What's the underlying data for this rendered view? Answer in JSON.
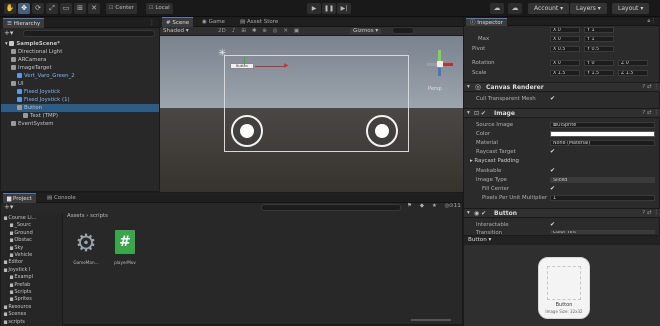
{
  "toolbar": {
    "center_label": "Center",
    "local_label": "Local",
    "account_label": "Account",
    "layers_label": "Layers",
    "layout_label": "Layout"
  },
  "hierarchy": {
    "tab": "Hierarchy",
    "add": "+",
    "items": [
      {
        "label": "SampleScene*",
        "indent": 0,
        "bold": true
      },
      {
        "label": "Directional Light",
        "indent": 1
      },
      {
        "label": "ARCamera",
        "indent": 1
      },
      {
        "label": "ImageTarget",
        "indent": 1
      },
      {
        "label": "Vert_Varo_Green_2",
        "indent": 2,
        "blue": true
      },
      {
        "label": "UI",
        "indent": 1
      },
      {
        "label": "Fixed Joystick",
        "indent": 2,
        "blue": true
      },
      {
        "label": "Fixed Joystick (1)",
        "indent": 2,
        "blue": true
      },
      {
        "label": "Button",
        "indent": 2,
        "selected": true
      },
      {
        "label": "Text (TMP)",
        "indent": 3
      },
      {
        "label": "EventSystem",
        "indent": 1
      }
    ]
  },
  "scene": {
    "tabs": [
      "Scene",
      "Game",
      "Asset Store"
    ],
    "shaded": "Shaded",
    "mode_2d": "2D",
    "gizmos": "Gizmos",
    "persp": "Persp",
    "button_text": "Button"
  },
  "project": {
    "tabs": [
      "Project",
      "Console"
    ],
    "breadcrumb": [
      "Assets",
      "scripts"
    ],
    "search_placeholder": "",
    "item_count": "11",
    "tree": [
      {
        "label": "Course Li...",
        "indent": 0
      },
      {
        "label": "_Sourc",
        "indent": 1
      },
      {
        "label": "Ground",
        "indent": 1
      },
      {
        "label": "Obstac",
        "indent": 1
      },
      {
        "label": "Sky",
        "indent": 1
      },
      {
        "label": "Vehicle",
        "indent": 1
      },
      {
        "label": "Editor",
        "indent": 0
      },
      {
        "label": "Joystick I",
        "indent": 0
      },
      {
        "label": "Exampl",
        "indent": 1
      },
      {
        "label": "Prefab",
        "indent": 1
      },
      {
        "label": "Scripts",
        "indent": 1
      },
      {
        "label": "Sprites",
        "indent": 1
      },
      {
        "label": "Resource",
        "indent": 0
      },
      {
        "label": "Scenes",
        "indent": 0
      },
      {
        "label": "scripts",
        "indent": 0
      }
    ],
    "assets": [
      {
        "label": "GameMan...",
        "icon": "gear-icon"
      },
      {
        "label": "playerMov",
        "icon": "csharp-script-icon"
      }
    ]
  },
  "inspector": {
    "tab": "Inspector",
    "transform": {
      "rows": [
        {
          "label": "Max",
          "x": "X 0",
          "y": "Y 1"
        },
        {
          "label": "Pivot",
          "x": "X 0.5",
          "y": "Y 0.5"
        },
        {
          "label": "Rotation",
          "x": "X 0",
          "y": "Y 0",
          "z": "Z 0"
        },
        {
          "label": "Scale",
          "x": "X 1.5",
          "y": "Y 1.5",
          "z": "Z 1.5"
        }
      ],
      "top_row": {
        "x": "X 0",
        "y": "Y 1"
      }
    },
    "canvas_renderer": {
      "title": "Canvas Renderer",
      "cull_label": "Cull Transparent Mesh",
      "cull_value": "✔"
    },
    "image": {
      "title": "Image",
      "source_label": "Source Image",
      "source_value": "UISprite",
      "color_label": "Color",
      "material_label": "Material",
      "material_value": "None (Material)",
      "raycast_label": "Raycast Target",
      "raycast_value": "✔",
      "raycast_padding_label": "Raycast Padding",
      "maskable_label": "Maskable",
      "maskable_value": "✔",
      "image_type_label": "Image Type",
      "image_type_value": "Sliced",
      "fill_center_label": "Fill Center",
      "fill_center_value": "✔",
      "ppu_label": "Pixels Per Unit Multiplier",
      "ppu_value": "1"
    },
    "button": {
      "title": "Button",
      "interactable_label": "Interactable",
      "interactable_value": "✔",
      "transition_label": "Transition",
      "transition_value": "Color Tint"
    },
    "preview": {
      "header": "Button",
      "caption": "Button",
      "size_text": "Image Size: 32x32"
    }
  }
}
